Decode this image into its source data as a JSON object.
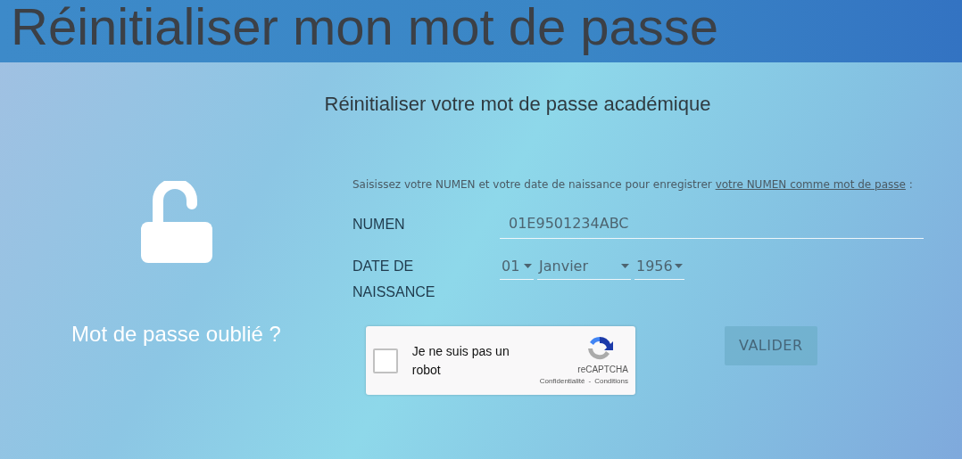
{
  "header": {
    "title": "Réinitialiser mon mot de passe"
  },
  "subtitle": "Réinitialiser votre mot de passe académique",
  "sidebar": {
    "caption": "Mot de passe oublié ?"
  },
  "form": {
    "intro_text": "Saisissez votre NUMEN et votre date de naissance pour enregistrer",
    "intro_link": "votre NUMEN comme mot de passe",
    "intro_end": " :",
    "fields": [
      {
        "label": "NUMEN",
        "value": "01E9501234ABC"
      }
    ],
    "birthdate": {
      "label": "DATE DE NAISSANCE",
      "day": "01",
      "month": "Janvier",
      "year": "1956"
    },
    "captcha": {
      "label": "Je ne suis pas un robot",
      "checked": false,
      "brand": "reCAPTCHA",
      "privacy": "Confidentialité",
      "separator": "-",
      "terms": "Conditions"
    },
    "submit": {
      "label": "VALIDER",
      "disabled": true
    }
  }
}
